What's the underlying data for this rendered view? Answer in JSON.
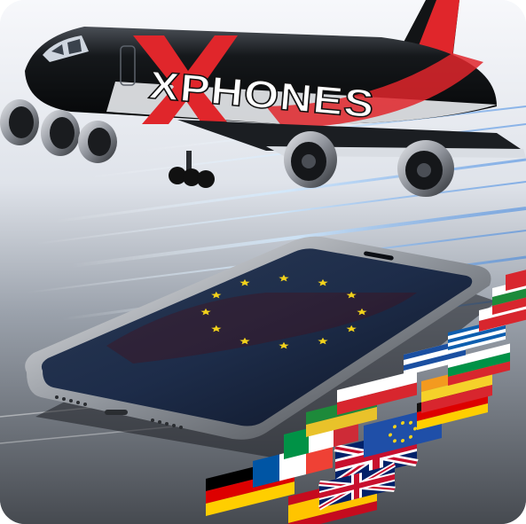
{
  "brand": {
    "logo_text": "XPHONES",
    "primary_color": "#e0262b",
    "body_color": "#121416"
  },
  "scene": {
    "subject": "airplane-over-smartphone-with-eu-flags",
    "eu_blue": "#1f4fa8",
    "eu_star_color": "#f2d21b"
  },
  "flags": [
    {
      "name": "germany-flag",
      "colors": [
        "#000000",
        "#dd0000",
        "#ffce00"
      ]
    },
    {
      "name": "uk-flag",
      "colors": [
        "#012169",
        "#ffffff",
        "#c8102e"
      ]
    },
    {
      "name": "eu-flag",
      "colors": [
        "#1f4fa8",
        "#f2d21b"
      ]
    },
    {
      "name": "italy-flag",
      "colors": [
        "#009246",
        "#ffffff",
        "#ce2b37"
      ]
    },
    {
      "name": "france-flag",
      "colors": [
        "#0055a4",
        "#ffffff",
        "#ef4135"
      ]
    },
    {
      "name": "spain-flag",
      "colors": [
        "#c60b1e",
        "#ffc400"
      ]
    }
  ]
}
